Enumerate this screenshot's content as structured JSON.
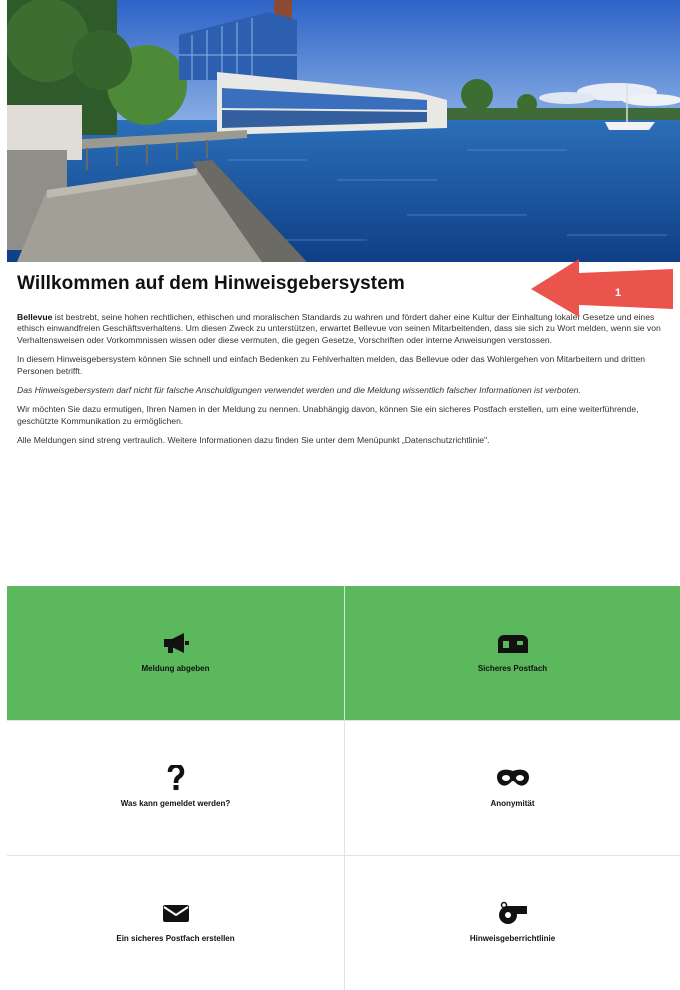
{
  "welcome": {
    "title": "Willkommen auf dem Hinweisgebersystem",
    "p1_brand": "Bellevue",
    "p1_rest": " ist bestrebt, seine hohen rechtlichen, ethischen und moralischen Standards zu wahren und fördert daher eine Kultur der Einhaltung lokaler Gesetze und eines ethisch einwandfreien Geschäftsverhaltens. Um diesen Zweck zu unterstützen, erwartet Bellevue von seinen Mitarbeitenden, dass sie sich zu Wort melden, wenn sie von Verhaltensweisen oder Vorkommnissen wissen oder diese vermuten, die gegen Gesetze, Vorschriften oder interne Anweisungen verstossen.",
    "p2": "In diesem Hinweisgebersystem können Sie schnell und einfach Bedenken zu Fehlverhalten melden, das Bellevue oder das Wohlergehen von Mitarbeitern und dritten Personen betrifft.",
    "p3": "Das Hinweisgebersystem darf nicht für falsche Anschuldigungen verwendet werden und die Meldung wissentlich falscher Informationen ist verboten.",
    "p4": "Wir möchten Sie dazu ermutigen, Ihren Namen in der Meldung zu nennen. Unabhängig davon, können Sie ein sicheres Postfach erstellen, um eine weiterführende, geschützte Kommunikation zu ermöglichen.",
    "p5": "Alle Meldungen sind streng vertraulich. Weitere Informationen dazu finden Sie unter dem Menüpunkt „Datenschutzrichtlinie\"."
  },
  "annotation": {
    "number": "1",
    "color": "#e8413a"
  },
  "tiles": [
    {
      "label": "Meldung abgeben",
      "icon": "megaphone-icon",
      "style": "green"
    },
    {
      "label": "Sicheres Postfach",
      "icon": "mailbox-icon",
      "style": "green"
    },
    {
      "label": "Was kann gemeldet werden?",
      "icon": "question-icon",
      "style": "white"
    },
    {
      "label": "Anonymität",
      "icon": "mask-icon",
      "style": "white"
    },
    {
      "label": "Ein sicheres Postfach erstellen",
      "icon": "envelope-icon",
      "style": "white"
    },
    {
      "label": "Hinweisgeberrichtlinie",
      "icon": "whistle-icon",
      "style": "white"
    }
  ],
  "colors": {
    "tile_green": "#5cb85c",
    "text": "#222222"
  }
}
